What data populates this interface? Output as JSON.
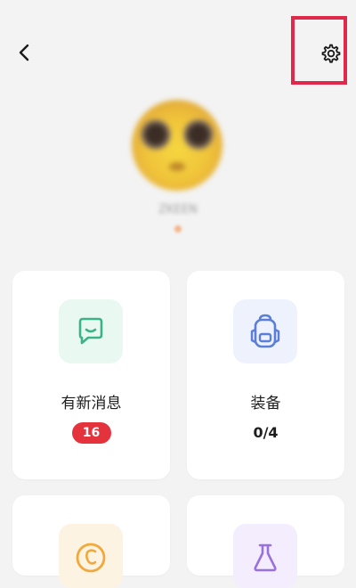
{
  "header": {
    "back_icon": "chevron-left-icon",
    "settings_icon": "gear-icon",
    "highlight_color": "#e0294a"
  },
  "profile": {
    "username": "ZKEEN"
  },
  "cards": [
    {
      "title": "有新消息",
      "badge": "16",
      "icon": "message-icon",
      "icon_color": "#3bb38a"
    },
    {
      "title": "装备",
      "value": "0/4",
      "icon": "backpack-icon",
      "icon_color": "#5b7ed8"
    },
    {
      "icon": "coin-icon",
      "icon_color": "#f0a93a"
    },
    {
      "icon": "flask-icon",
      "icon_color": "#9a6fe0"
    }
  ],
  "colors": {
    "background": "#f3f3f3",
    "card": "#ffffff",
    "badge": "#e5333e"
  }
}
